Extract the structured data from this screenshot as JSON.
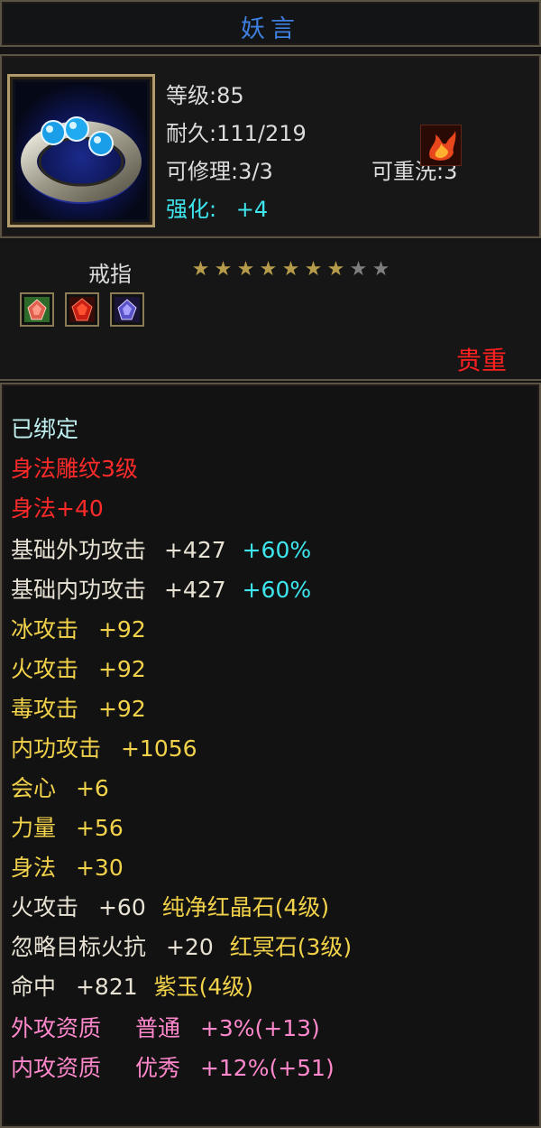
{
  "item": {
    "name": "妖言",
    "level": "等级:85",
    "durability": "耐久:111/219",
    "repair": "可修理:3/3",
    "rewash": "可重洗:3",
    "enhance_label": "强化:",
    "enhance_value": "+4",
    "type": "戒指",
    "stars": {
      "filled": 7,
      "total": 9
    },
    "rarity": "贵重",
    "colors": {
      "title": "#3f7fe0",
      "rarity": "#ff2020",
      "enhance": "#3ee6ee"
    },
    "icons": [
      "ring-icon",
      "flame-icon",
      "green-gem-icon",
      "red-gem-icon",
      "purple-gem-icon"
    ]
  },
  "props": {
    "bound": "已绑定",
    "carving": "身法雕纹3级",
    "carving_bonus": "身法+40",
    "base_outer_attack": {
      "label": "基础外功攻击",
      "value": "+427",
      "pct": "+60%"
    },
    "base_inner_attack": {
      "label": "基础内功攻击",
      "value": "+427",
      "pct": "+60%"
    },
    "ice_attack": {
      "label": "冰攻击",
      "value": "+92"
    },
    "fire_attack": {
      "label": "火攻击",
      "value": "+92"
    },
    "poison_attack": {
      "label": "毒攻击",
      "value": "+92"
    },
    "inner_attack": {
      "label": "内功攻击",
      "value": "+1056"
    },
    "crit": {
      "label": "会心",
      "value": "+6"
    },
    "strength": {
      "label": "力量",
      "value": "+56"
    },
    "agility": {
      "label": "身法",
      "value": "+30"
    },
    "gem_fire": {
      "label": "火攻击",
      "value": "+60",
      "gem": "纯净红晶石(4级)"
    },
    "gem_ignore": {
      "label": "忽略目标火抗",
      "value": "+20",
      "gem": "红冥石(3级)"
    },
    "gem_hit": {
      "label": "命中",
      "value": "+821",
      "gem": "紫玉(4级)"
    },
    "outer_aptitude": {
      "label": "外攻资质",
      "grade": "普通",
      "value": "+3%(+13)"
    },
    "inner_aptitude": {
      "label": "内攻资质",
      "grade": "优秀",
      "value": "+12%(+51)"
    }
  }
}
